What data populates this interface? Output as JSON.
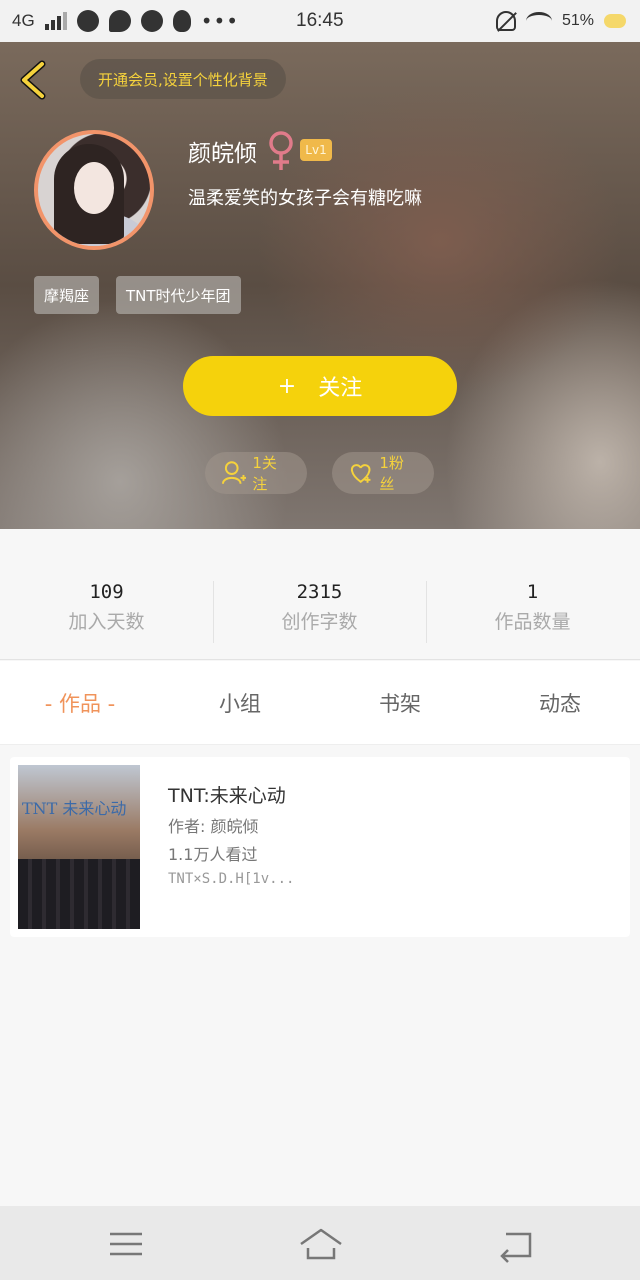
{
  "status_bar": {
    "network": "4G",
    "time": "16:45",
    "battery": "51%"
  },
  "header": {
    "vip_banner": "开通会员,设置个性化背景",
    "username": "颜皖倾",
    "level": "Lv1",
    "signature": "温柔爱笑的女孩子会有糖吃嘛",
    "tags": [
      "摩羯座",
      "TNT时代少年团"
    ],
    "follow_button": "关注",
    "follow_plus": "+",
    "following": "1关注",
    "fans": "1粉丝"
  },
  "stats": [
    {
      "value": "109",
      "label": "加入天数"
    },
    {
      "value": "2315",
      "label": "创作字数"
    },
    {
      "value": "1",
      "label": "作品数量"
    }
  ],
  "tabs": [
    "- 作品 -",
    "小组",
    "书架",
    "动态"
  ],
  "books": [
    {
      "title": "TNT:未来心动",
      "author": "作者: 颜皖倾",
      "views": "1.1万人看过",
      "desc": "TNT×S.D.H[1v...",
      "cover_text": "TNT 未来心动"
    }
  ],
  "colors": {
    "accent_yellow": "#f5d20c",
    "tab_active": "#f0935a",
    "avatar_border": "#f2946a"
  }
}
